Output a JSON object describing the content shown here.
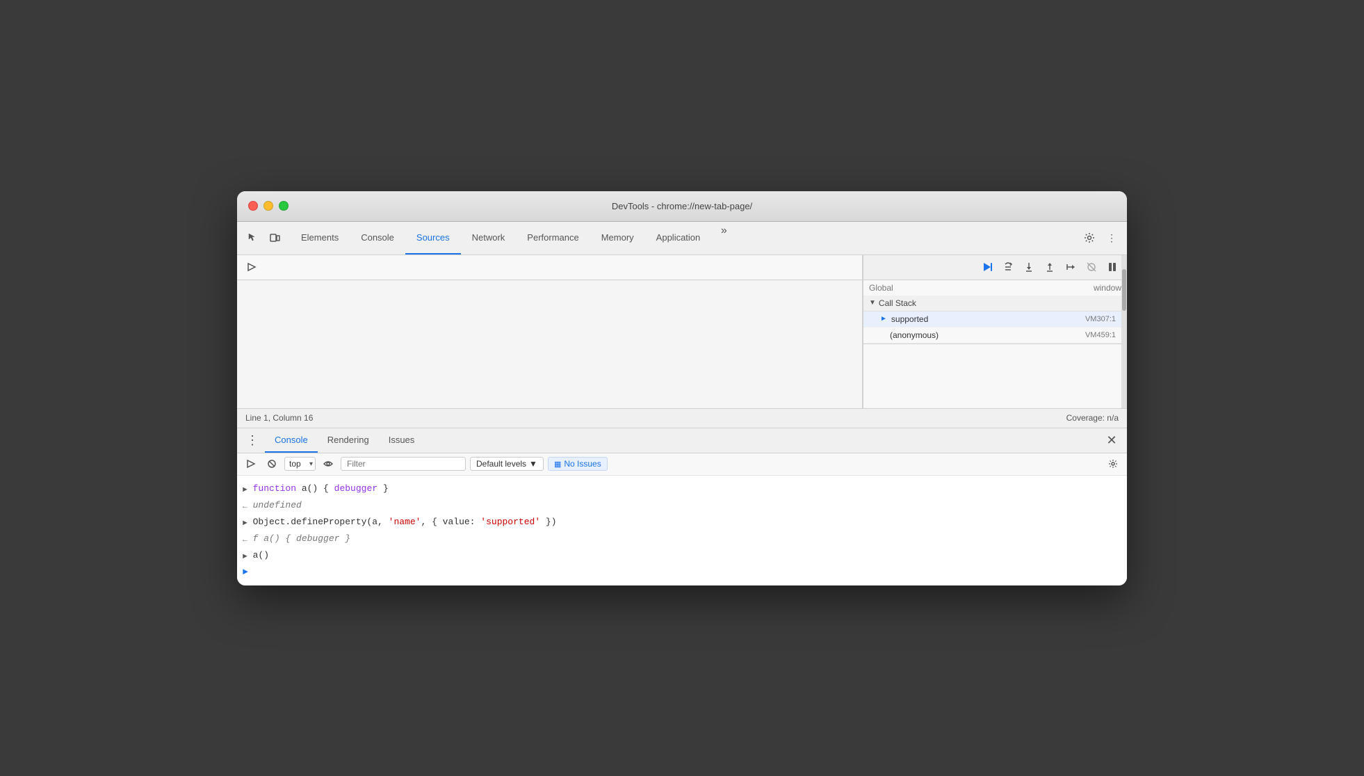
{
  "window": {
    "title": "DevTools - chrome://new-tab-page/"
  },
  "toolbar": {
    "tabs": [
      {
        "label": "Elements",
        "active": false
      },
      {
        "label": "Console",
        "active": false
      },
      {
        "label": "Sources",
        "active": true
      },
      {
        "label": "Network",
        "active": false
      },
      {
        "label": "Performance",
        "active": false
      },
      {
        "label": "Memory",
        "active": false
      },
      {
        "label": "Application",
        "active": false
      }
    ]
  },
  "status_bar": {
    "position": "Line 1, Column 16",
    "coverage": "Coverage: n/a"
  },
  "call_stack": {
    "header": "Call Stack",
    "items": [
      {
        "name": "supported",
        "location": "VM307:1",
        "active": true
      },
      {
        "name": "(anonymous)",
        "location": "VM459:1",
        "active": false
      }
    ],
    "truncated": {
      "left": "Global",
      "right": "window"
    }
  },
  "console_panel": {
    "tabs": [
      {
        "label": "Console",
        "active": true
      },
      {
        "label": "Rendering",
        "active": false
      },
      {
        "label": "Issues",
        "active": false
      }
    ],
    "toolbar": {
      "context": "top",
      "filter_placeholder": "Filter",
      "levels_label": "Default levels",
      "no_issues_label": "No Issues"
    },
    "lines": [
      {
        "type": "input",
        "content": "function a() { debugger }",
        "parts": [
          {
            "text": "function ",
            "class": "code-purple"
          },
          {
            "text": "a() { ",
            "class": "code-dark"
          },
          {
            "text": "debugger",
            "class": "code-purple"
          },
          {
            "text": " }",
            "class": "code-dark"
          }
        ]
      },
      {
        "type": "output",
        "content": "undefined",
        "parts": [
          {
            "text": "undefined",
            "class": "code-gray"
          }
        ]
      },
      {
        "type": "input",
        "content": "Object.defineProperty(a, 'name', { value: 'supported' })",
        "parts": [
          {
            "text": "Object.defineProperty(a, ",
            "class": "code-dark"
          },
          {
            "text": "'name'",
            "class": "code-red"
          },
          {
            "text": ", { value: ",
            "class": "code-dark"
          },
          {
            "text": "'supported'",
            "class": "code-red"
          },
          {
            "text": " })",
            "class": "code-dark"
          }
        ]
      },
      {
        "type": "output",
        "content": "f a() { debugger }",
        "parts": [
          {
            "text": "f a() { ",
            "class": "code-gray"
          },
          {
            "text": "debugger",
            "class": "code-gray"
          },
          {
            "text": " }",
            "class": "code-gray"
          }
        ]
      },
      {
        "type": "input",
        "content": "a()",
        "parts": [
          {
            "text": "a()",
            "class": "code-dark"
          }
        ]
      }
    ]
  }
}
